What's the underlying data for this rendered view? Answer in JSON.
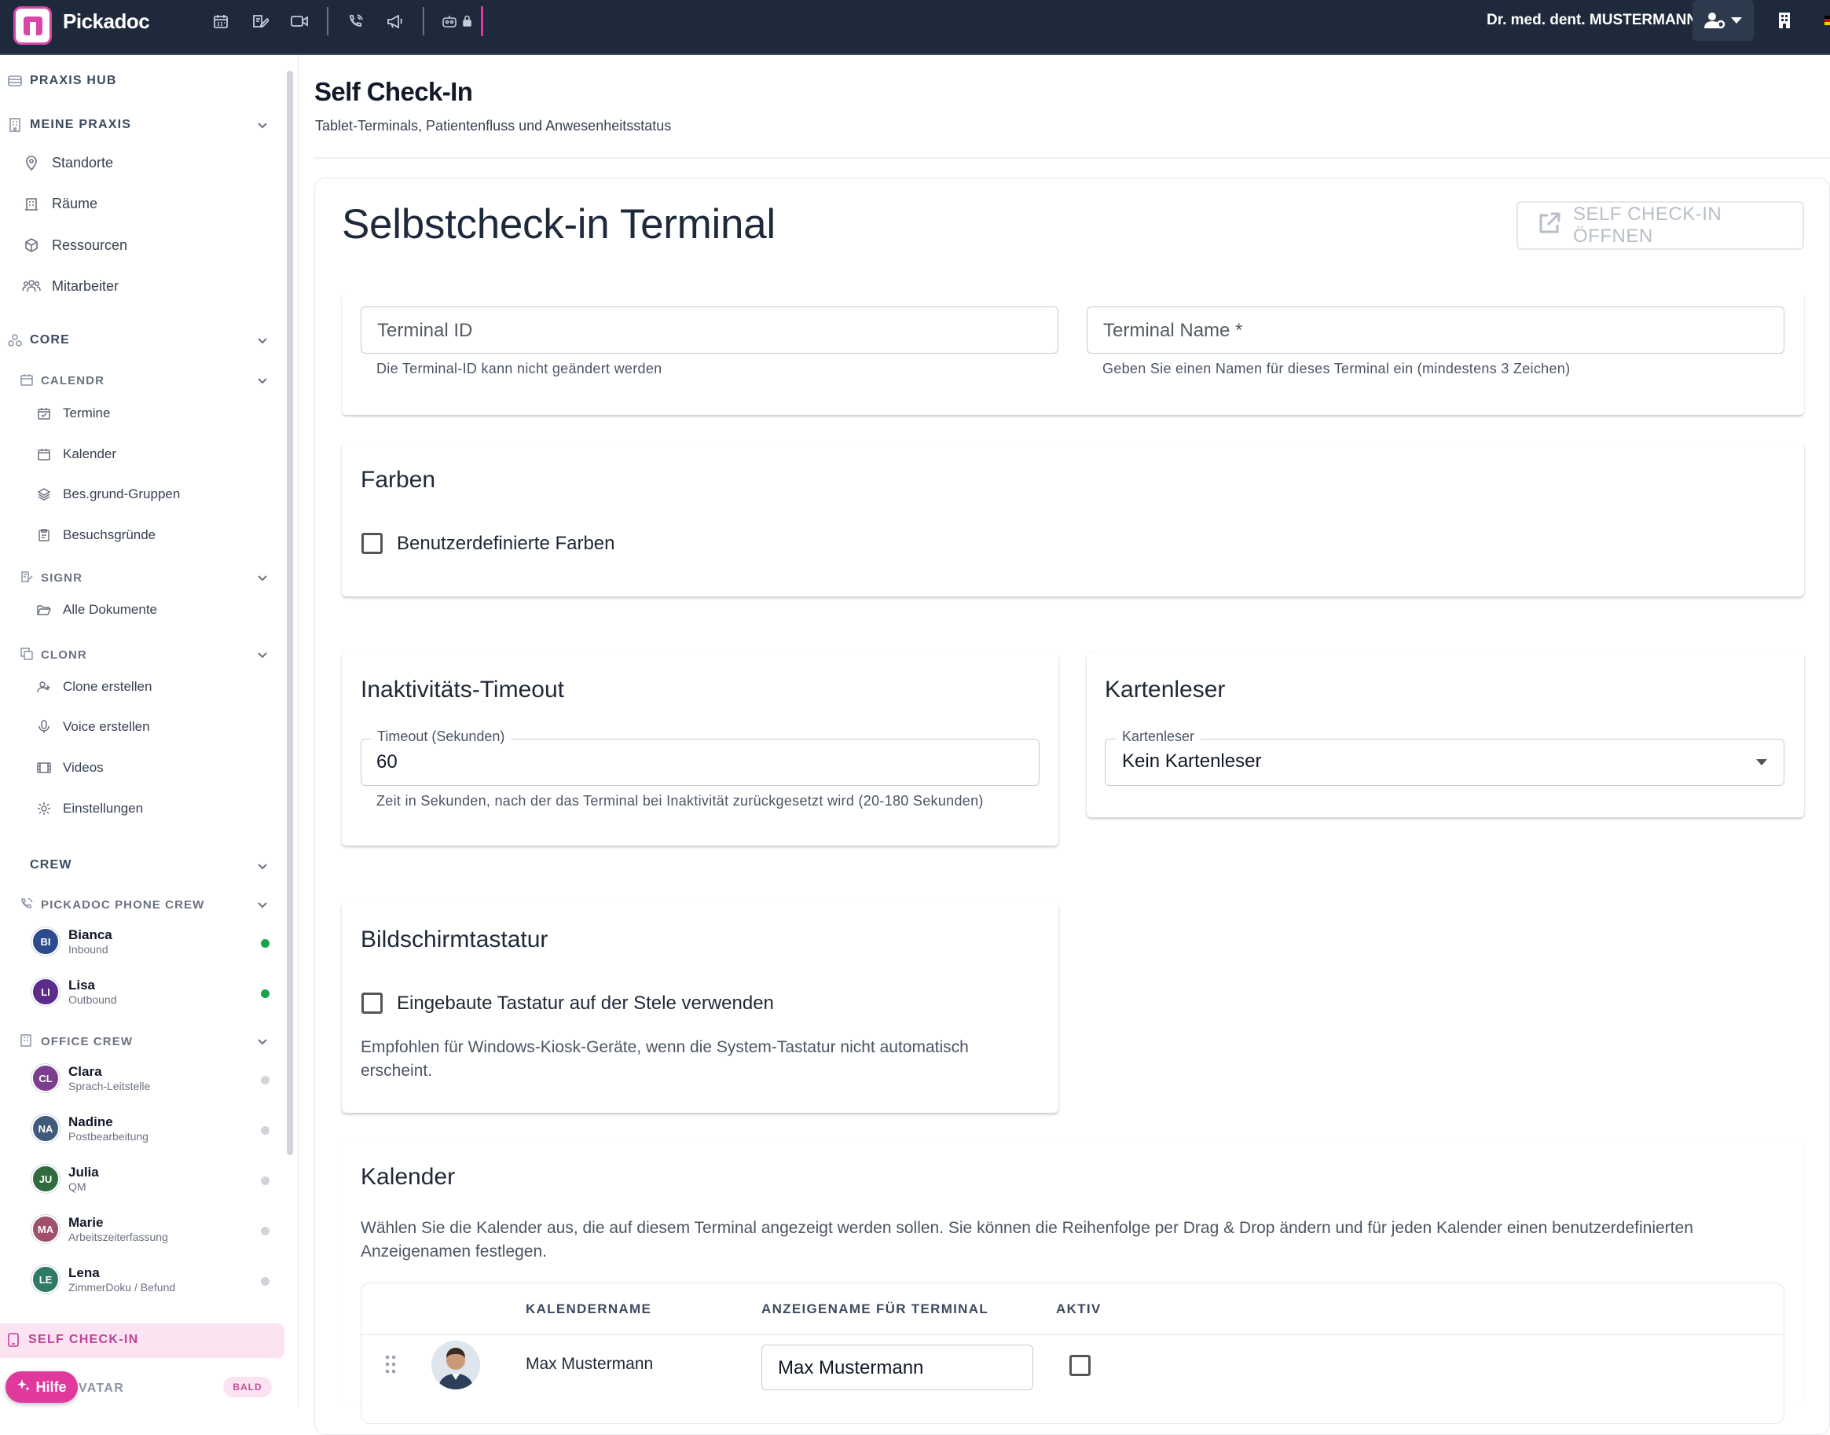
{
  "topbar": {
    "brand": "Pickadoc",
    "user": "Dr. med. dent. MUSTERMANN",
    "icons": [
      "calendar-icon",
      "sign-icon",
      "video-icon",
      "phone-icon",
      "megaphone-icon",
      "robot-icon",
      "lock-icon"
    ]
  },
  "sidebar": {
    "praxis_hub": "PRAXIS HUB",
    "meine_praxis": "MEINE PRAXIS",
    "meine_items": [
      "Standorte",
      "Räume",
      "Ressourcen",
      "Mitarbeiter"
    ],
    "core": "CORE",
    "calendr": "CALENDR",
    "calendr_items": [
      "Termine",
      "Kalender",
      "Bes.grund-Gruppen",
      "Besuchsgründe"
    ],
    "signr": "SIGNR",
    "signr_items": [
      "Alle Dokumente"
    ],
    "clonr": "CLONR",
    "clonr_items": [
      "Clone erstellen",
      "Voice erstellen",
      "Videos",
      "Einstellungen"
    ],
    "crew": "CREW",
    "phone_crew": "PICKADOC PHONE CREW",
    "phone_members": [
      {
        "initials": "BI",
        "name": "Bianca",
        "role": "Inbound",
        "color": "#2c4a8c",
        "status": "#16a34a"
      },
      {
        "initials": "LI",
        "name": "Lisa",
        "role": "Outbound",
        "color": "#5b2c8c",
        "status": "#16a34a"
      }
    ],
    "office_crew": "OFFICE CREW",
    "office_members": [
      {
        "initials": "CL",
        "name": "Clara",
        "role": "Sprach-Leitstelle",
        "color": "#7b3f8c",
        "status": "#d1d5db"
      },
      {
        "initials": "NA",
        "name": "Nadine",
        "role": "Postbearbeitung",
        "color": "#3f5a7a",
        "status": "#d1d5db"
      },
      {
        "initials": "JU",
        "name": "Julia",
        "role": "QM",
        "color": "#2f6b3f",
        "status": "#d1d5db"
      },
      {
        "initials": "MA",
        "name": "Marie",
        "role": "Arbeitszeiterfassung",
        "color": "#a0506a",
        "status": "#d1d5db"
      },
      {
        "initials": "LE",
        "name": "Lena",
        "role": "ZimmerDoku / Befund",
        "color": "#2f7a66",
        "status": "#d1d5db"
      }
    ],
    "self_checkin": "SELF CHECK-IN",
    "avatar_partial": "VATAR",
    "bald": "BALD",
    "hilfe": "Hilfe"
  },
  "page": {
    "title": "Self Check-In",
    "subtitle": "Tablet-Terminals, Patientenfluss und Anwesenheitsstatus"
  },
  "terminal": {
    "heading": "Selbstcheck-in Terminal",
    "open_button": "SELF CHECK-IN ÖFFNEN",
    "id_placeholder": "Terminal ID",
    "id_help": "Die Terminal-ID kann nicht geändert werden",
    "name_placeholder": "Terminal Name *",
    "name_help": "Geben Sie einen Namen für dieses Terminal ein (mindestens 3 Zeichen)"
  },
  "farben": {
    "title": "Farben",
    "checkbox": "Benutzerdefinierte Farben",
    "checked": false
  },
  "timeout": {
    "title": "Inaktivitäts-Timeout",
    "label": "Timeout (Sekunden)",
    "value": "60",
    "help": "Zeit in Sekunden, nach der das Terminal bei Inaktivität zurückgesetzt wird (20-180 Sekunden)"
  },
  "kartenleser": {
    "title": "Kartenleser",
    "label": "Kartenleser",
    "value": "Kein Kartenleser"
  },
  "tastatur": {
    "title": "Bildschirmtastatur",
    "checkbox": "Eingebaute Tastatur auf der Stele verwenden",
    "checked": false,
    "note": "Empfohlen für Windows-Kiosk-Geräte, wenn die System-Tastatur nicht automatisch erscheint."
  },
  "kalender": {
    "title": "Kalender",
    "description": "Wählen Sie die Kalender aus, die auf diesem Terminal angezeigt werden sollen. Sie können die Reihenfolge per Drag & Drop ändern und für jeden Kalender einen benutzerdefinierten Anzeigenamen festlegen.",
    "columns": [
      "KALENDERNAME",
      "ANZEIGENAME FÜR TERMINAL",
      "AKTIV"
    ],
    "rows": [
      {
        "name": "Max Mustermann",
        "display": "Max Mustermann",
        "active": false
      }
    ]
  }
}
